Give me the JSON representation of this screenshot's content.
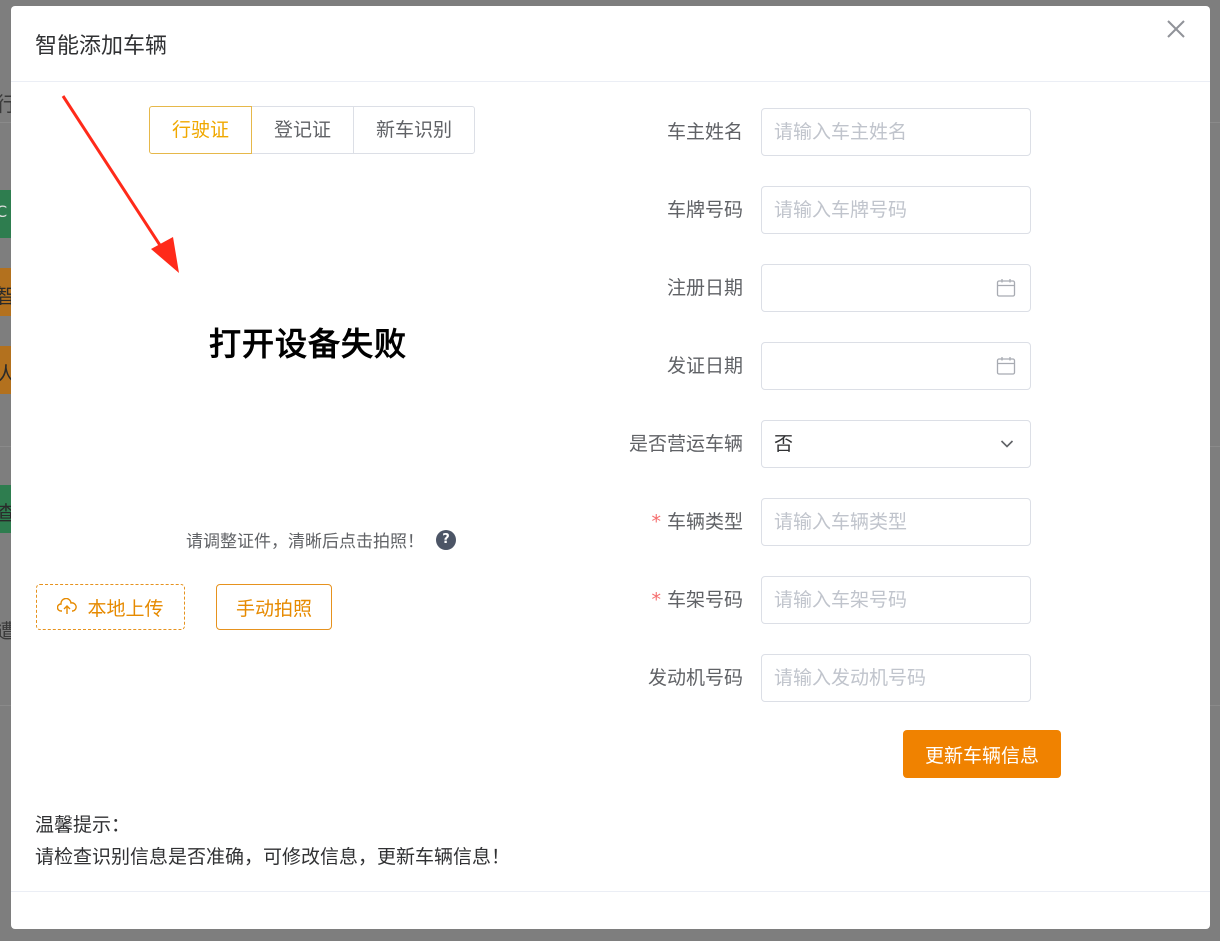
{
  "dialog": {
    "title": "智能添加车辆"
  },
  "tabs": [
    {
      "label": "行驶证",
      "active": true
    },
    {
      "label": "登记证",
      "active": false
    },
    {
      "label": "新车识别",
      "active": false
    }
  ],
  "camera": {
    "status_text": "打开设备失败",
    "hint": "请调整证件，清晰后点击拍照！",
    "help_symbol": "?"
  },
  "buttons": {
    "upload_label": "本地上传",
    "photo_label": "手动拍照",
    "submit_label": "更新车辆信息"
  },
  "form": {
    "owner_name": {
      "label": "车主姓名",
      "placeholder": "请输入车主姓名",
      "required": false
    },
    "plate_number": {
      "label": "车牌号码",
      "placeholder": "请输入车牌号码",
      "required": false
    },
    "register_date": {
      "label": "注册日期",
      "value": "",
      "required": false
    },
    "issue_date": {
      "label": "发证日期",
      "value": "",
      "required": false
    },
    "is_commercial": {
      "label": "是否营运车辆",
      "value": "否",
      "required": false
    },
    "vehicle_type": {
      "label": "车辆类型",
      "placeholder": "请输入车辆类型",
      "required": true
    },
    "vin": {
      "label": "车架号码",
      "placeholder": "请输入车架号码",
      "required": true
    },
    "engine_number": {
      "label": "发动机号码",
      "placeholder": "请输入发动机号码",
      "required": false
    },
    "required_mark": "*"
  },
  "tips": {
    "title": "温馨提示：",
    "body": "请检查识别信息是否准确，可修改信息，更新车辆信息！"
  },
  "background": {
    "fragments": [
      "行",
      "C",
      "智",
      "人",
      "查",
      "遭"
    ]
  },
  "colors": {
    "accent": "#f08200",
    "active_tab": "#f0a800",
    "required": "#f56c6c",
    "annotation_arrow": "#ff2a1a"
  },
  "icons": {
    "close": "close-icon",
    "calendar": "calendar-icon",
    "chevron": "chevron-down-icon",
    "upload": "cloud-upload-icon",
    "help": "question-circle-icon"
  }
}
